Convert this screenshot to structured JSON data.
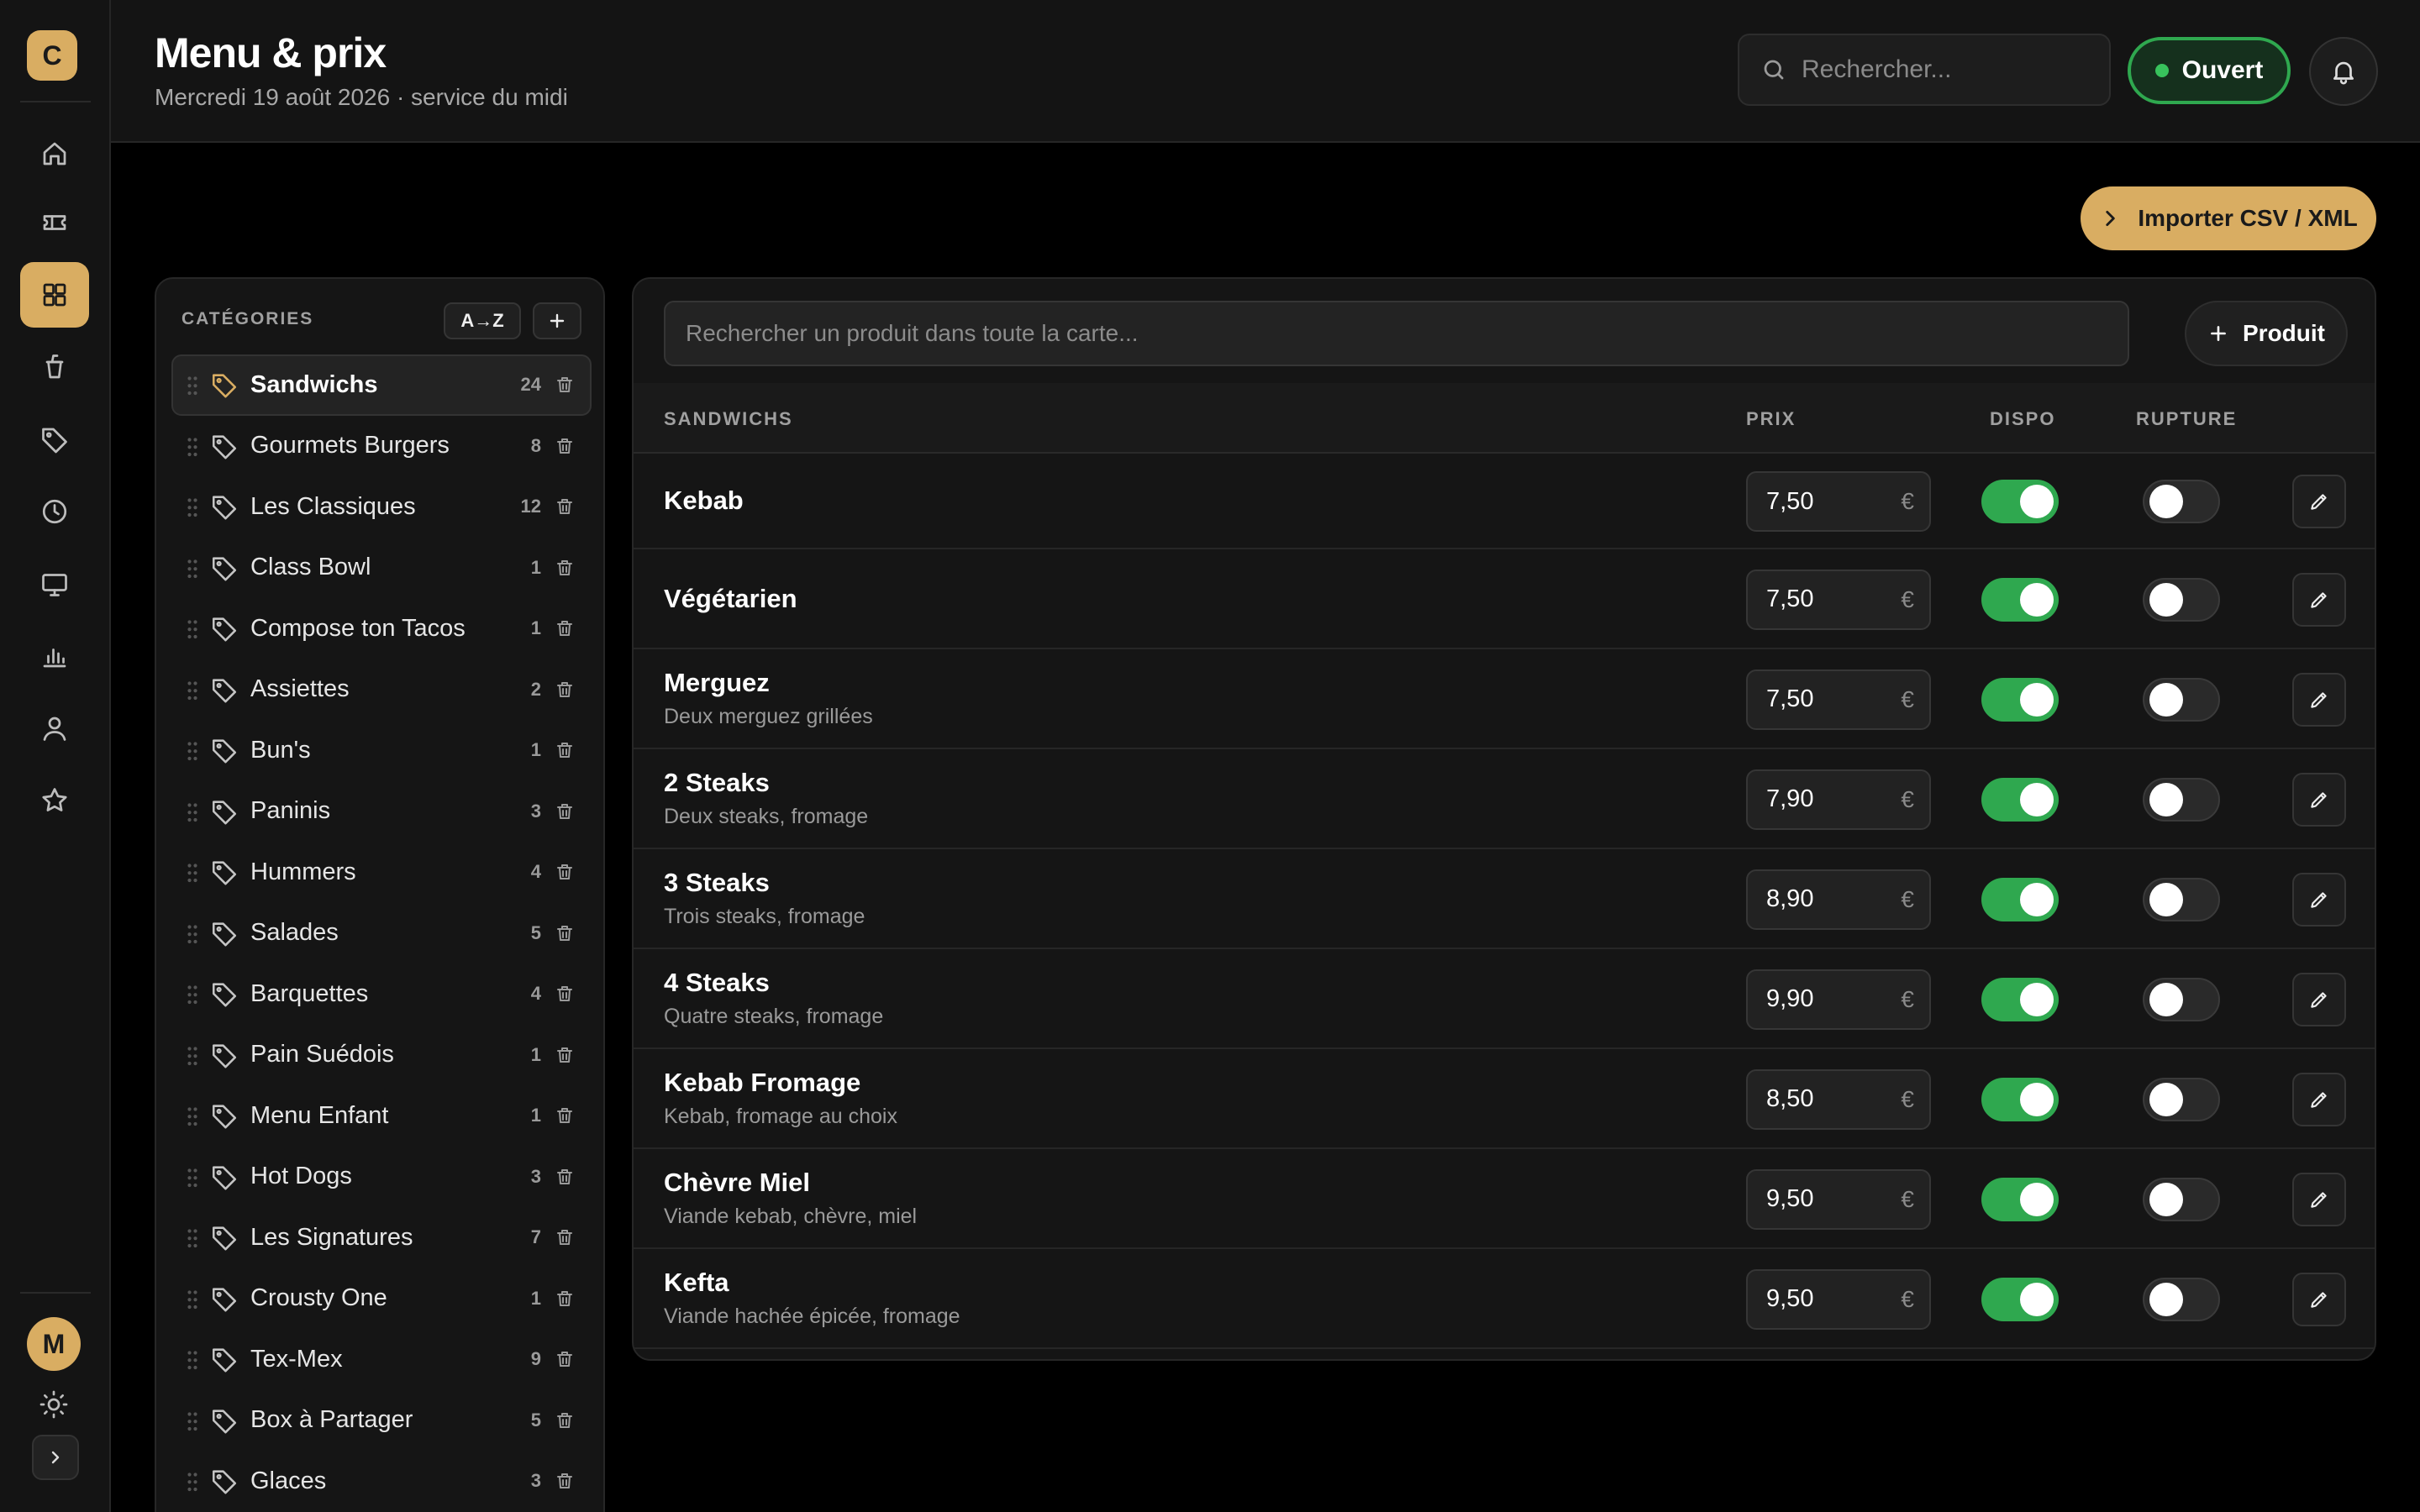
{
  "rail": {
    "logo_letter": "C",
    "items": [
      {
        "name": "home-icon",
        "active": false
      },
      {
        "name": "ticket-icon",
        "active": false
      },
      {
        "name": "grid-icon",
        "active": true
      },
      {
        "name": "drink-cup-icon",
        "active": false
      },
      {
        "name": "tag-icon",
        "active": false
      },
      {
        "name": "clock-icon",
        "active": false
      },
      {
        "name": "monitor-icon",
        "active": false
      },
      {
        "name": "bar-chart-icon",
        "active": false
      },
      {
        "name": "user-icon",
        "active": false
      },
      {
        "name": "star-icon",
        "active": false
      }
    ],
    "avatar_letter": "M"
  },
  "header": {
    "title": "Menu & prix",
    "subtitle": "Mercredi 19 août 2026 · service du midi",
    "search_placeholder": "Rechercher...",
    "status_label": "Ouvert"
  },
  "toolbar": {
    "import_label": "Importer CSV / XML"
  },
  "categories": {
    "heading": "CATÉGORIES",
    "sort_label": "A→Z",
    "items": [
      {
        "name": "Sandwichs",
        "count": "24",
        "active": true
      },
      {
        "name": "Gourmets Burgers",
        "count": "8",
        "active": false
      },
      {
        "name": "Les Classiques",
        "count": "12",
        "active": false
      },
      {
        "name": "Class Bowl",
        "count": "1",
        "active": false
      },
      {
        "name": "Compose ton Tacos",
        "count": "1",
        "active": false
      },
      {
        "name": "Assiettes",
        "count": "2",
        "active": false
      },
      {
        "name": "Bun's",
        "count": "1",
        "active": false
      },
      {
        "name": "Paninis",
        "count": "3",
        "active": false
      },
      {
        "name": "Hummers",
        "count": "4",
        "active": false
      },
      {
        "name": "Salades",
        "count": "5",
        "active": false
      },
      {
        "name": "Barquettes",
        "count": "4",
        "active": false
      },
      {
        "name": "Pain Suédois",
        "count": "1",
        "active": false
      },
      {
        "name": "Menu Enfant",
        "count": "1",
        "active": false
      },
      {
        "name": "Hot Dogs",
        "count": "3",
        "active": false
      },
      {
        "name": "Les Signatures",
        "count": "7",
        "active": false
      },
      {
        "name": "Crousty One",
        "count": "1",
        "active": false
      },
      {
        "name": "Tex-Mex",
        "count": "9",
        "active": false
      },
      {
        "name": "Box à Partager",
        "count": "5",
        "active": false
      },
      {
        "name": "Glaces",
        "count": "3",
        "active": false
      }
    ]
  },
  "products": {
    "search_placeholder": "Rechercher un produit dans toute la carte...",
    "add_label": "Produit",
    "columns": {
      "category": "SANDWICHS",
      "price": "PRIX",
      "dispo": "DISPO",
      "rupture": "RUPTURE"
    },
    "currency": "€",
    "colors": {
      "accent": "#d9ad62",
      "toggle_on": "#2fa84f"
    },
    "rows": [
      {
        "name": "Kebab",
        "desc": "",
        "price": "7,50",
        "dispo": true,
        "rupture": false
      },
      {
        "name": "Végétarien",
        "desc": "",
        "price": "7,50",
        "dispo": true,
        "rupture": false
      },
      {
        "name": "Merguez",
        "desc": "Deux merguez grillées",
        "price": "7,50",
        "dispo": true,
        "rupture": false
      },
      {
        "name": "2 Steaks",
        "desc": "Deux steaks, fromage",
        "price": "7,90",
        "dispo": true,
        "rupture": false
      },
      {
        "name": "3 Steaks",
        "desc": "Trois steaks, fromage",
        "price": "8,90",
        "dispo": true,
        "rupture": false
      },
      {
        "name": "4 Steaks",
        "desc": "Quatre steaks, fromage",
        "price": "9,90",
        "dispo": true,
        "rupture": false
      },
      {
        "name": "Kebab Fromage",
        "desc": "Kebab, fromage au choix",
        "price": "8,50",
        "dispo": true,
        "rupture": false
      },
      {
        "name": "Chèvre Miel",
        "desc": "Viande kebab, chèvre, miel",
        "price": "9,50",
        "dispo": true,
        "rupture": false
      },
      {
        "name": "Kefta",
        "desc": "Viande hachée épicée, fromage",
        "price": "9,50",
        "dispo": true,
        "rupture": false
      }
    ]
  }
}
